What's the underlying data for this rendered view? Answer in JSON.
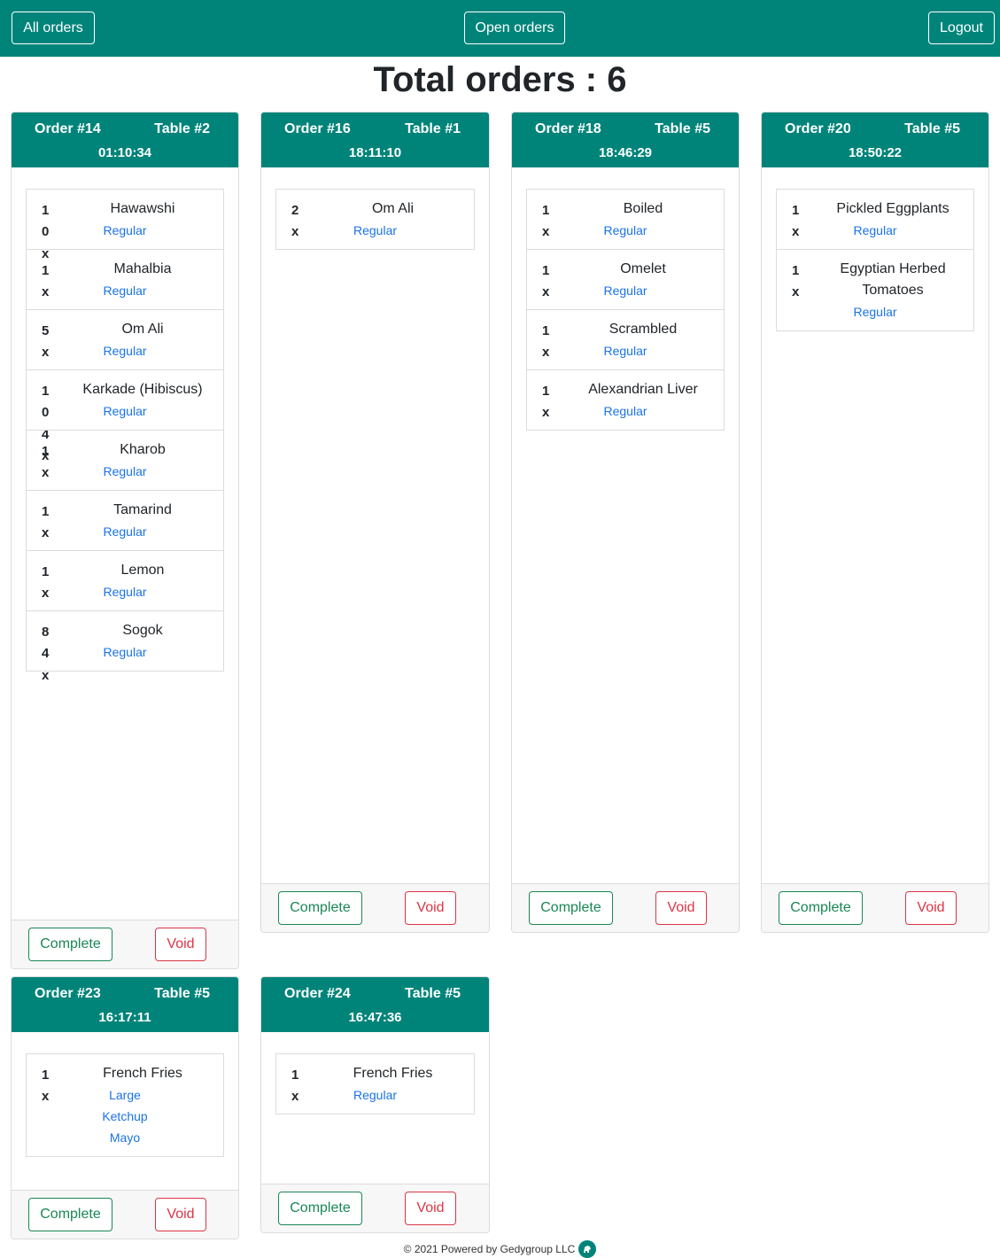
{
  "nav": {
    "all_orders": "All orders",
    "open_orders": "Open orders",
    "logout": "Logout"
  },
  "title": "Total orders : 6",
  "complete_label": "Complete",
  "void_label": "Void",
  "orders": [
    {
      "order": "Order #14",
      "table": "Table #2",
      "time": "01:10:34",
      "items": [
        {
          "qty": "10x",
          "name": "Hawawshi",
          "options": [
            "Regular"
          ]
        },
        {
          "qty": "1x",
          "name": "Mahalbia",
          "options": [
            "Regular"
          ]
        },
        {
          "qty": "5x",
          "name": "Om Ali",
          "options": [
            "Regular"
          ]
        },
        {
          "qty": "104x",
          "name": "Karkade (Hibiscus)",
          "options": [
            "Regular"
          ]
        },
        {
          "qty": "1x",
          "name": "Kharob",
          "options": [
            "Regular"
          ]
        },
        {
          "qty": "1x",
          "name": "Tamarind",
          "options": [
            "Regular"
          ]
        },
        {
          "qty": "1x",
          "name": "Lemon",
          "options": [
            "Regular"
          ]
        },
        {
          "qty": "84x",
          "name": "Sogok",
          "options": [
            "Regular"
          ]
        }
      ]
    },
    {
      "order": "Order #16",
      "table": "Table #1",
      "time": "18:11:10",
      "items": [
        {
          "qty": "2x",
          "name": "Om Ali",
          "options": [
            "Regular"
          ]
        }
      ]
    },
    {
      "order": "Order #18",
      "table": "Table #5",
      "time": "18:46:29",
      "items": [
        {
          "qty": "1x",
          "name": "Boiled",
          "options": [
            "Regular"
          ]
        },
        {
          "qty": "1x",
          "name": "Omelet",
          "options": [
            "Regular"
          ]
        },
        {
          "qty": "1x",
          "name": "Scrambled",
          "options": [
            "Regular"
          ]
        },
        {
          "qty": "1x",
          "name": "Alexandrian Liver",
          "options": [
            "Regular"
          ]
        }
      ]
    },
    {
      "order": "Order #20",
      "table": "Table #5",
      "time": "18:50:22",
      "items": [
        {
          "qty": "1x",
          "name": "Pickled Eggplants",
          "options": [
            "Regular"
          ]
        },
        {
          "qty": "1x",
          "name": "Egyptian Herbed Tomatoes",
          "options": [
            "Regular"
          ]
        }
      ]
    },
    {
      "order": "Order #23",
      "table": "Table #5",
      "time": "16:17:11",
      "items": [
        {
          "qty": "1x",
          "name": "French Fries",
          "options": [
            "Large",
            "Ketchup",
            "Mayo"
          ]
        }
      ]
    },
    {
      "order": "Order #24",
      "table": "Table #5",
      "time": "16:47:36",
      "items": [
        {
          "qty": "1x",
          "name": "French Fries",
          "options": [
            "Regular"
          ]
        }
      ]
    }
  ],
  "footer": {
    "text": "© 2021 Powered by Gedygroup LLC"
  }
}
